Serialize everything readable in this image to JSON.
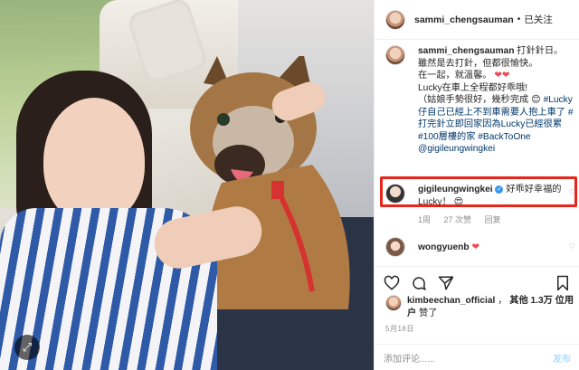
{
  "post": {
    "header": {
      "username": "sammi_chengsauman",
      "separator": "•",
      "follow_status": "已关注"
    },
    "caption": {
      "username": "sammi_chengsauman",
      "line1": "打針針日。",
      "line2": "雖然是去打針，但都很愉快。",
      "line3": "在一起，就溫馨。",
      "line4": "Lucky在車上全程都好乖哦!",
      "line5": "（姑娘手勢很好，幾秒完成",
      "hashtags_line": "#Lucky仔自己已經上不到車需要人抱上車了 #打完針立即回家因為Lucky已經很累 #100層樓的家 #BackToOne",
      "mention": "@gigileungwingkei"
    },
    "highlighted_comment": {
      "username": "gigileungwingkei",
      "verified_mark": "✓",
      "text": "好乖好幸福的Lucky！",
      "time": "1周",
      "likes": "27 次赞",
      "reply": "回复"
    },
    "comment2": {
      "username": "wongyuenb"
    },
    "likes": {
      "user": "kimbeechan_official",
      "others": "其他 1.3万 位用户",
      "suffix": "赞了"
    },
    "date": "5月16日",
    "add_comment": {
      "placeholder": "添加评论......",
      "post_label": "发布"
    }
  },
  "colors": {
    "accent_blue": "#00376b",
    "heart_red": "#ed4956",
    "highlight_border": "#e8251a",
    "verified_blue": "#3897f0"
  }
}
